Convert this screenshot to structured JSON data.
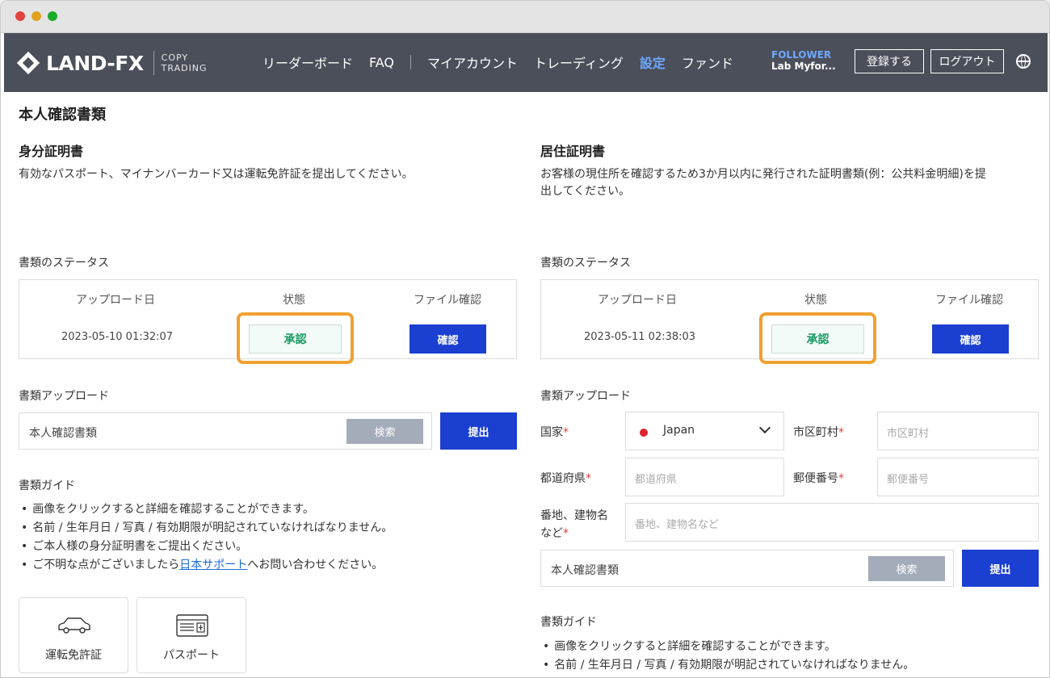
{
  "window": {
    "controls": [
      "close",
      "minimize",
      "zoom"
    ]
  },
  "header": {
    "logo_text": "LAND-FX",
    "logo_sub_line1": "COPY",
    "logo_sub_line2": "TRADING",
    "nav": [
      "リーダーボード",
      "FAQ",
      "マイアカウント",
      "トレーディング",
      "設定",
      "ファンド"
    ],
    "active_nav": "設定",
    "follower_role": "FOLLOWER",
    "follower_name": "Lab Myfor...",
    "register_label": "登録する",
    "logout_label": "ログアウト",
    "globe_icon": "globe-icon"
  },
  "page": {
    "title": "本人確認書類"
  },
  "identity": {
    "title": "身分証明書",
    "description": "有効なパスポート、マイナンバーカード又は運転免許証を提出してください。",
    "status_label": "書類のステータス",
    "table_headers": [
      "アップロード日",
      "状態",
      "ファイル確認"
    ],
    "upload_date": "2023-05-10 01:32:07",
    "status": "承認",
    "confirm_label": "確認",
    "upload_label": "書類アップロード",
    "file_placeholder": "本人確認書類",
    "search_label": "検索",
    "submit_label": "提出",
    "guide_title": "書類ガイド",
    "guide_items": [
      "画像をクリックすると詳細を確認することができます。",
      "名前 / 生年月日 / 写真 / 有効期限が明記されていなければなりません。",
      "ご本人様の身分証明書をご提出ください。"
    ],
    "guide_last_pre": "ご不明な点がございましたら",
    "guide_last_link": "日本サポート",
    "guide_last_post": "へお問い合わせください。",
    "cards": [
      "運転免許証",
      "パスポート"
    ]
  },
  "residence": {
    "title": "居住証明書",
    "description_line1": "お客様の現住所を確認するため3か月以内に発行された証明書類(例：公共料金明細)を提",
    "description_line2": "出してください。",
    "status_label": "書類のステータス",
    "table_headers": [
      "アップロード日",
      "状態",
      "ファイル確認"
    ],
    "upload_date": "2023-05-11 02:38:03",
    "status": "承認",
    "confirm_label": "確認",
    "upload_label": "書類アップロード",
    "country_label": "国家",
    "country_value": "Japan",
    "city_label": "市区町村",
    "city_placeholder": "市区町村",
    "prefecture_label": "都道府県",
    "prefecture_placeholder": "都道府県",
    "postal_label": "郵便番号",
    "postal_placeholder": "郵便番号",
    "address_label_line1": "番地、建物名",
    "address_label_line2": "など",
    "address_placeholder": "番地、建物名など",
    "required_mark": "*",
    "file_placeholder": "本人確認書類",
    "search_label": "検索",
    "submit_label": "提出",
    "guide_title": "書類ガイド",
    "guide_items": [
      "画像をクリックすると詳細を確認することができます。",
      "名前 / 生年月日 / 写真 / 有効期限が明記されていなければなりません。"
    ]
  },
  "colors": {
    "nav_bg": "#4b4f5a",
    "accent_blue": "#1b3fd1",
    "highlight": "#f0a030",
    "approved_green": "#1a9a63"
  }
}
